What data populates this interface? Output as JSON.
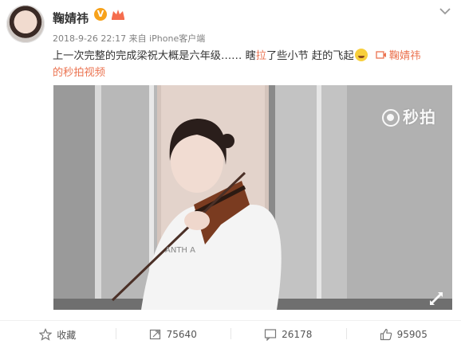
{
  "post": {
    "username": "鞠婧祎",
    "verified_badge": "V",
    "meta": "2018-9-26 22:17 来自 iPhone客户端",
    "text_before": "上一次完整的完成梁祝大概是六年级……   瞎",
    "text_accent": "拉",
    "text_after": "了些小节 赶的飞起",
    "video_link_author": "鞠婧祎",
    "video_link_label": "的秒拍视频"
  },
  "video": {
    "watermark": "秒拍"
  },
  "actions": {
    "favorite": {
      "label": "收藏"
    },
    "repost": {
      "count": "75640"
    },
    "comment": {
      "count": "26178"
    },
    "like": {
      "count": "95905"
    }
  },
  "colors": {
    "link": "#eb7350",
    "verified_badge": "#f7a21b"
  }
}
